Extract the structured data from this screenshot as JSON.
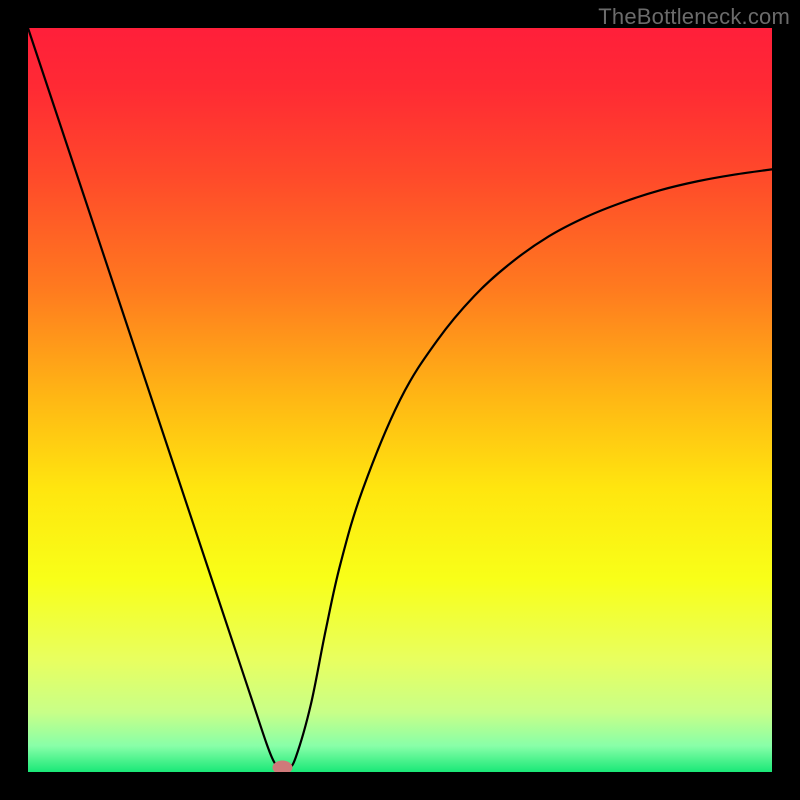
{
  "watermark": "TheBottleneck.com",
  "chart_data": {
    "type": "line",
    "title": "",
    "xlabel": "",
    "ylabel": "",
    "xlim": [
      0,
      100
    ],
    "ylim": [
      0,
      100
    ],
    "grid": false,
    "legend": false,
    "series": [
      {
        "name": "bottleneck-curve",
        "x": [
          0,
          5,
          10,
          15,
          20,
          25,
          28,
          30,
          32,
          33,
          34,
          35,
          36,
          38,
          40,
          42,
          45,
          50,
          55,
          60,
          65,
          70,
          75,
          80,
          85,
          90,
          95,
          100
        ],
        "values": [
          100,
          85,
          70,
          55,
          40,
          25,
          16,
          10,
          4,
          1.5,
          0.2,
          0.5,
          2,
          9,
          19,
          28,
          38,
          50,
          58,
          64,
          68.5,
          72,
          74.6,
          76.6,
          78.2,
          79.4,
          80.3,
          81
        ]
      }
    ],
    "marker": {
      "x": 34.2,
      "y": 0.6,
      "color": "#cf7a7a"
    },
    "gradient_stops": [
      {
        "offset": 0.0,
        "color": "#ff1f3a"
      },
      {
        "offset": 0.08,
        "color": "#ff2a34"
      },
      {
        "offset": 0.2,
        "color": "#ff4a2a"
      },
      {
        "offset": 0.35,
        "color": "#ff7a1f"
      },
      {
        "offset": 0.5,
        "color": "#ffb814"
      },
      {
        "offset": 0.62,
        "color": "#ffe60f"
      },
      {
        "offset": 0.74,
        "color": "#f8ff18"
      },
      {
        "offset": 0.85,
        "color": "#e8ff60"
      },
      {
        "offset": 0.92,
        "color": "#c8ff88"
      },
      {
        "offset": 0.965,
        "color": "#88ffa8"
      },
      {
        "offset": 1.0,
        "color": "#1ae877"
      }
    ]
  }
}
